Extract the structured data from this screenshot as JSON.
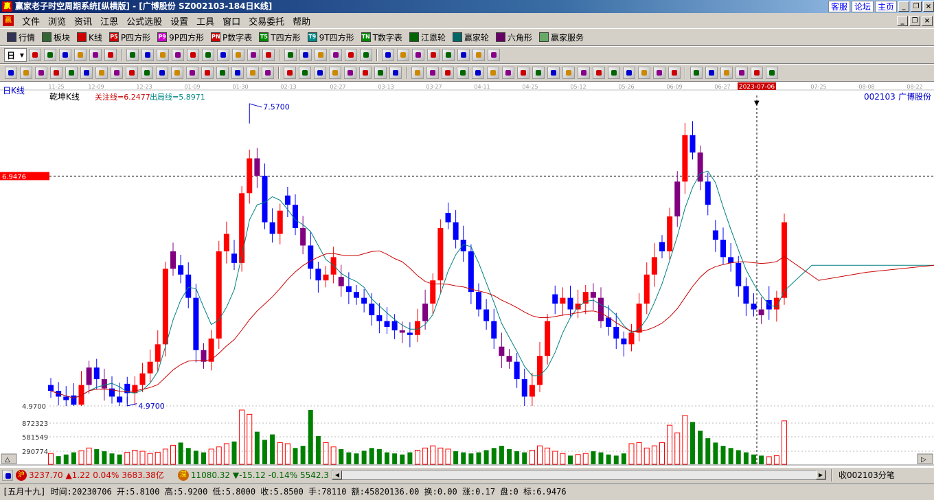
{
  "window": {
    "app_icon": "赢",
    "title": "赢家老子时空周期系统[纵横版] - [广博股份   SZ002103-184日K线]",
    "links": [
      "客服",
      "论坛",
      "主页"
    ]
  },
  "menu": {
    "logo": "赢",
    "items": [
      "文件",
      "浏览",
      "资讯",
      "江恩",
      "公式选股",
      "设置",
      "工具",
      "窗口",
      "交易委托",
      "帮助"
    ]
  },
  "toolbar1": [
    {
      "icon": "table-icon",
      "label": "行情",
      "color": "#335"
    },
    {
      "icon": "blocks-icon",
      "label": "板块",
      "color": "#363"
    },
    {
      "icon": "candle-icon",
      "label": "K线",
      "color": "#c00"
    },
    {
      "icon": "P5",
      "label": "P四方形",
      "color": "#c00"
    },
    {
      "icon": "P9",
      "label": "9P四方形",
      "color": "#c0c"
    },
    {
      "icon": "PN",
      "label": "P数字表",
      "color": "#c00"
    },
    {
      "icon": "T5",
      "label": "T四方形",
      "color": "#080"
    },
    {
      "icon": "T9",
      "label": "9T四方形",
      "color": "#088"
    },
    {
      "icon": "TN",
      "label": "T数字表",
      "color": "#080"
    },
    {
      "icon": "wheel-icon",
      "label": "江恩轮",
      "color": "#060"
    },
    {
      "icon": "wheel2-icon",
      "label": "赢家轮",
      "color": "#066"
    },
    {
      "icon": "hexagon-icon",
      "label": "六角形",
      "color": "#606"
    },
    {
      "icon": "dollar-icon",
      "label": "赢家服务",
      "color": "#6a6"
    }
  ],
  "toolbar2_period": "日",
  "chart": {
    "period_label": "日K线",
    "indicator_name": "乾坤K线",
    "focus_line": "关注线=6.2477",
    "exit_line": "出局线=5.8971",
    "stock_code": "002103",
    "stock_name": "广博股份",
    "cursor_date": "2023-07-06",
    "cursor_price": "6.9476",
    "high_label": "7.5700",
    "low_label": "4.9700",
    "volume_axis": [
      "4.9700",
      "872323",
      "581549",
      "290774"
    ],
    "date_ticks": [
      "11-25",
      "12-09",
      "12-23",
      "01-09",
      "01-30",
      "02-13",
      "02-27",
      "03-13",
      "03-27",
      "04-11",
      "04-25",
      "05-12",
      "05-26",
      "06-09",
      "06-27",
      "2023-07-06",
      "07-25",
      "08-08",
      "08-22"
    ]
  },
  "chart_data": {
    "type": "candlestick",
    "title": "广博股份 002103 日K线",
    "price_range": [
      4.97,
      7.57
    ],
    "high": 7.57,
    "low": 4.97,
    "focus_line": 6.2477,
    "exit_line": 5.8971,
    "cursor_price": 6.9476,
    "candles_close_approx": [
      5.1,
      5.05,
      5.02,
      4.98,
      5.15,
      5.3,
      5.2,
      5.12,
      5.05,
      5.0,
      5.08,
      5.15,
      5.25,
      5.35,
      5.5,
      6.15,
      6.3,
      6.1,
      5.9,
      5.45,
      5.35,
      5.55,
      6.3,
      6.45,
      6.2,
      6.8,
      7.1,
      6.95,
      6.55,
      6.45,
      6.65,
      6.7,
      6.5,
      6.35,
      6.15,
      6.05,
      6.1,
      6.25,
      6.0,
      5.95,
      5.9,
      5.85,
      5.75,
      5.7,
      5.65,
      5.62,
      5.6,
      5.58,
      5.7,
      5.85,
      6.05,
      6.5,
      6.55,
      6.4,
      6.3,
      5.95,
      5.8,
      5.7,
      5.55,
      5.4,
      5.35,
      5.2,
      5.05,
      5.15,
      5.4,
      5.7,
      5.85,
      5.9,
      5.8,
      5.85,
      5.95,
      5.9,
      5.7,
      5.65,
      5.55,
      5.5,
      5.6,
      5.85,
      6.1,
      6.25,
      6.3,
      6.6,
      6.9,
      7.3,
      7.15,
      6.9,
      6.7,
      6.4,
      6.25,
      6.2,
      6.0,
      5.85,
      5.8,
      5.75,
      5.8,
      5.9,
      6.55
    ]
  },
  "volume_data": {
    "values_relative": [
      0.2,
      0.15,
      0.18,
      0.22,
      0.25,
      0.3,
      0.28,
      0.24,
      0.2,
      0.18,
      0.22,
      0.26,
      0.24,
      0.2,
      0.22,
      0.28,
      0.35,
      0.4,
      0.3,
      0.25,
      0.22,
      0.28,
      0.32,
      0.38,
      0.42,
      1.0,
      0.92,
      0.6,
      0.45,
      0.55,
      0.4,
      0.38,
      0.3,
      0.34,
      1.0,
      0.52,
      0.4,
      0.32,
      0.28,
      0.22,
      0.2,
      0.25,
      0.3,
      0.28,
      0.22,
      0.2,
      0.18,
      0.22,
      0.26,
      0.3,
      0.34,
      0.3,
      0.28,
      0.24,
      0.22,
      0.2,
      0.22,
      0.26,
      0.3,
      0.34,
      0.28,
      0.24,
      0.22,
      0.26,
      0.34,
      0.3,
      0.24,
      0.2,
      0.16,
      0.18,
      0.2,
      0.24,
      0.22,
      0.18,
      0.16,
      0.2,
      0.38,
      0.4,
      0.3,
      0.34,
      0.4,
      0.72,
      0.58,
      0.9,
      0.78,
      0.62,
      0.48,
      0.4,
      0.34,
      0.3,
      0.26,
      0.22,
      0.18,
      0.16,
      0.14,
      0.16,
      0.8
    ]
  },
  "status1": {
    "sh_badge": "沪",
    "sh_index": "3237.70",
    "sh_change": "▲1.22",
    "sh_pct": "0.04%",
    "sh_amount": "3683.38亿",
    "sz_badge": "深",
    "sz_index": "11080.32",
    "sz_change": "▼-15.12",
    "sz_pct": "-0.14%",
    "sz_amount": "5542.3",
    "right_label": "收002103分笔"
  },
  "status2": {
    "text": "[五月十九] 时间:20230706 开:5.8100 高:5.9200 低:5.8000 收:5.8500 手:78110 额:45820136.00 换:0.00 涨:0.17 盘:0 标:6.9476"
  },
  "colors": {
    "up": "#ff0000",
    "down": "#0000ff",
    "neutral": "#800080",
    "volume_up": "#ff0000",
    "volume_down": "#008000",
    "focus_line": "#cc0000",
    "exit_line": "#008080",
    "title_gradient_start": "#0a246a"
  }
}
